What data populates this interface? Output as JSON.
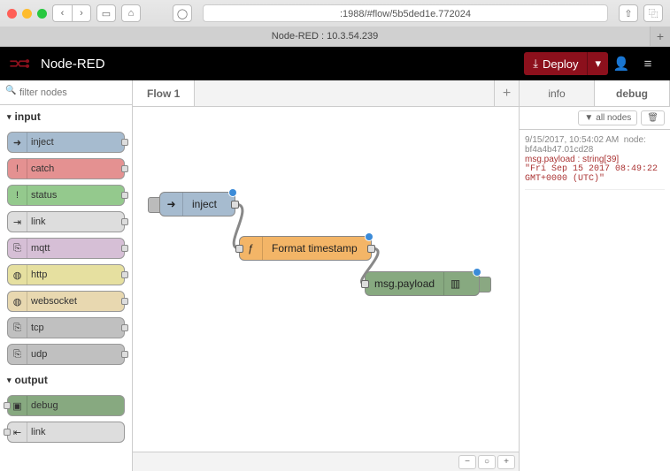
{
  "browser": {
    "url": ":1988/#flow/5b5ded1e.772024",
    "tab_title": "Node-RED : 10.3.54.239"
  },
  "header": {
    "app_name": "Node-RED",
    "deploy_label": "Deploy"
  },
  "palette": {
    "filter_placeholder": "filter nodes",
    "categories": [
      {
        "name": "input",
        "nodes": [
          "inject",
          "catch",
          "status",
          "link",
          "mqtt",
          "http",
          "websocket",
          "tcp",
          "udp"
        ]
      },
      {
        "name": "output",
        "nodes": [
          "debug",
          "link"
        ]
      }
    ]
  },
  "workspace": {
    "tab": "Flow 1",
    "nodes": {
      "n1": "inject",
      "n2": "Format timestamp",
      "n3": "msg.payload"
    }
  },
  "sidebar": {
    "tabs": {
      "info": "info",
      "debug": "debug"
    },
    "filter_btn": "all nodes",
    "msg": {
      "time": "9/15/2017, 10:54:02 AM",
      "source": "node:",
      "id": "bf4a4b47.01cd28",
      "key": "msg.payload : string[39]",
      "value": "\"Fri Sep 15 2017 08:49:22 GMT+0000 (UTC)\""
    }
  }
}
